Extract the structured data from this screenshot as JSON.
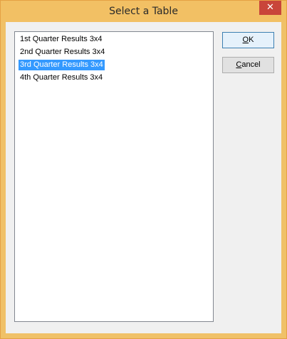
{
  "window": {
    "title": "Select a Table",
    "close_glyph": "✕"
  },
  "list": {
    "items": [
      {
        "label": "1st Quarter Results 3x4",
        "selected": false
      },
      {
        "label": "2nd Quarter Results 3x4",
        "selected": false
      },
      {
        "label": "3rd Quarter Results 3x4",
        "selected": true
      },
      {
        "label": "4th Quarter Results 3x4",
        "selected": false
      }
    ]
  },
  "buttons": {
    "ok": {
      "mnemonic": "O",
      "rest": "K"
    },
    "cancel": {
      "mnemonic": "C",
      "rest": "ancel"
    }
  },
  "colors": {
    "title_bar": "#f2c064",
    "close_button": "#c9453a",
    "selection": "#3399ff"
  }
}
